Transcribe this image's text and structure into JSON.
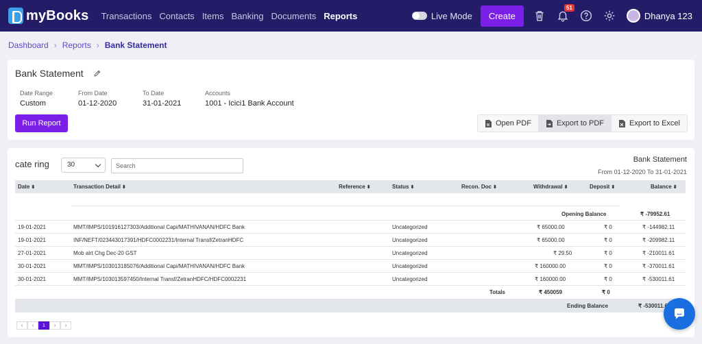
{
  "app": {
    "name": "myBooks"
  },
  "nav": {
    "links": [
      "Transactions",
      "Contacts",
      "Items",
      "Banking",
      "Documents",
      "Reports"
    ],
    "live_mode": "Live Mode",
    "create": "Create",
    "notifications_badge": "51",
    "username": "Dhanya 123"
  },
  "breadcrumb": [
    "Dashboard",
    "Reports",
    "Bank Statement"
  ],
  "report": {
    "title": "Bank Statement",
    "fields": [
      {
        "label": "Date Range",
        "value": "Custom"
      },
      {
        "label": "From Date",
        "value": "01-12-2020"
      },
      {
        "label": "To Date",
        "value": "31-01-2021"
      },
      {
        "label": "Accounts",
        "value": "1001 - Icici1 Bank Account"
      }
    ],
    "run_button": "Run Report",
    "exports": [
      "Open PDF",
      "Export to PDF",
      "Export to Excel"
    ]
  },
  "table_section": {
    "title": "cate ring",
    "page_size": "30",
    "search_placeholder": "Search",
    "report_title": "Bank Statement",
    "report_range": "From 01-12-2020 To 31-01-2021",
    "columns": [
      "Date",
      "Transaction Detail",
      "Reference",
      "Status",
      "Recon. Doc",
      "Withdrawal",
      "Deposit",
      "Balance"
    ],
    "opening_label": "Opening Balance",
    "opening_value": "₹  -79952.61",
    "rows": [
      {
        "date": "19-01-2021",
        "detail": "MMT/IMPS/101916127303/Additional Capi/MATHIVANAN/HDFC Bank",
        "status": "Uncategorized",
        "withdrawal": "₹ 65000.00",
        "deposit": "₹ 0",
        "balance": "₹ -144982.11"
      },
      {
        "date": "19-01-2021",
        "detail": "INF/NEFT/023443017391/HDFC0002231/Internal Transf/ZetranHDFC",
        "status": "Uncategorized",
        "withdrawal": "₹ 65000.00",
        "deposit": "₹ 0",
        "balance": "₹ -209982.11"
      },
      {
        "date": "27-01-2021",
        "detail": "Mob alrt Chg Dec-20 GST",
        "status": "Uncategorized",
        "withdrawal": "₹ 29.50",
        "deposit": "₹ 0",
        "balance": "₹ -210011.61"
      },
      {
        "date": "30-01-2021",
        "detail": "MMT/IMPS/103013185076/Additional Capi/MATHIVANAN/HDFC Bank",
        "status": "Uncategorized",
        "withdrawal": "₹ 160000.00",
        "deposit": "₹ 0",
        "balance": "₹ -370011.61"
      },
      {
        "date": "30-01-2021",
        "detail": "MMT/IMPS/103013597450/Internal Transf/ZetranHDFC/HDFC0002231",
        "status": "Uncategorized",
        "withdrawal": "₹ 160000.00",
        "deposit": "₹ 0",
        "balance": "₹ -530011.61"
      }
    ],
    "totals_label": "Totals",
    "totals_withdrawal": "₹  450059",
    "totals_deposit": "₹  0",
    "ending_label": "Ending Balance",
    "ending_value": "₹  -530011.61",
    "pages": [
      "‹",
      "‹",
      "1",
      "›",
      "›"
    ]
  }
}
